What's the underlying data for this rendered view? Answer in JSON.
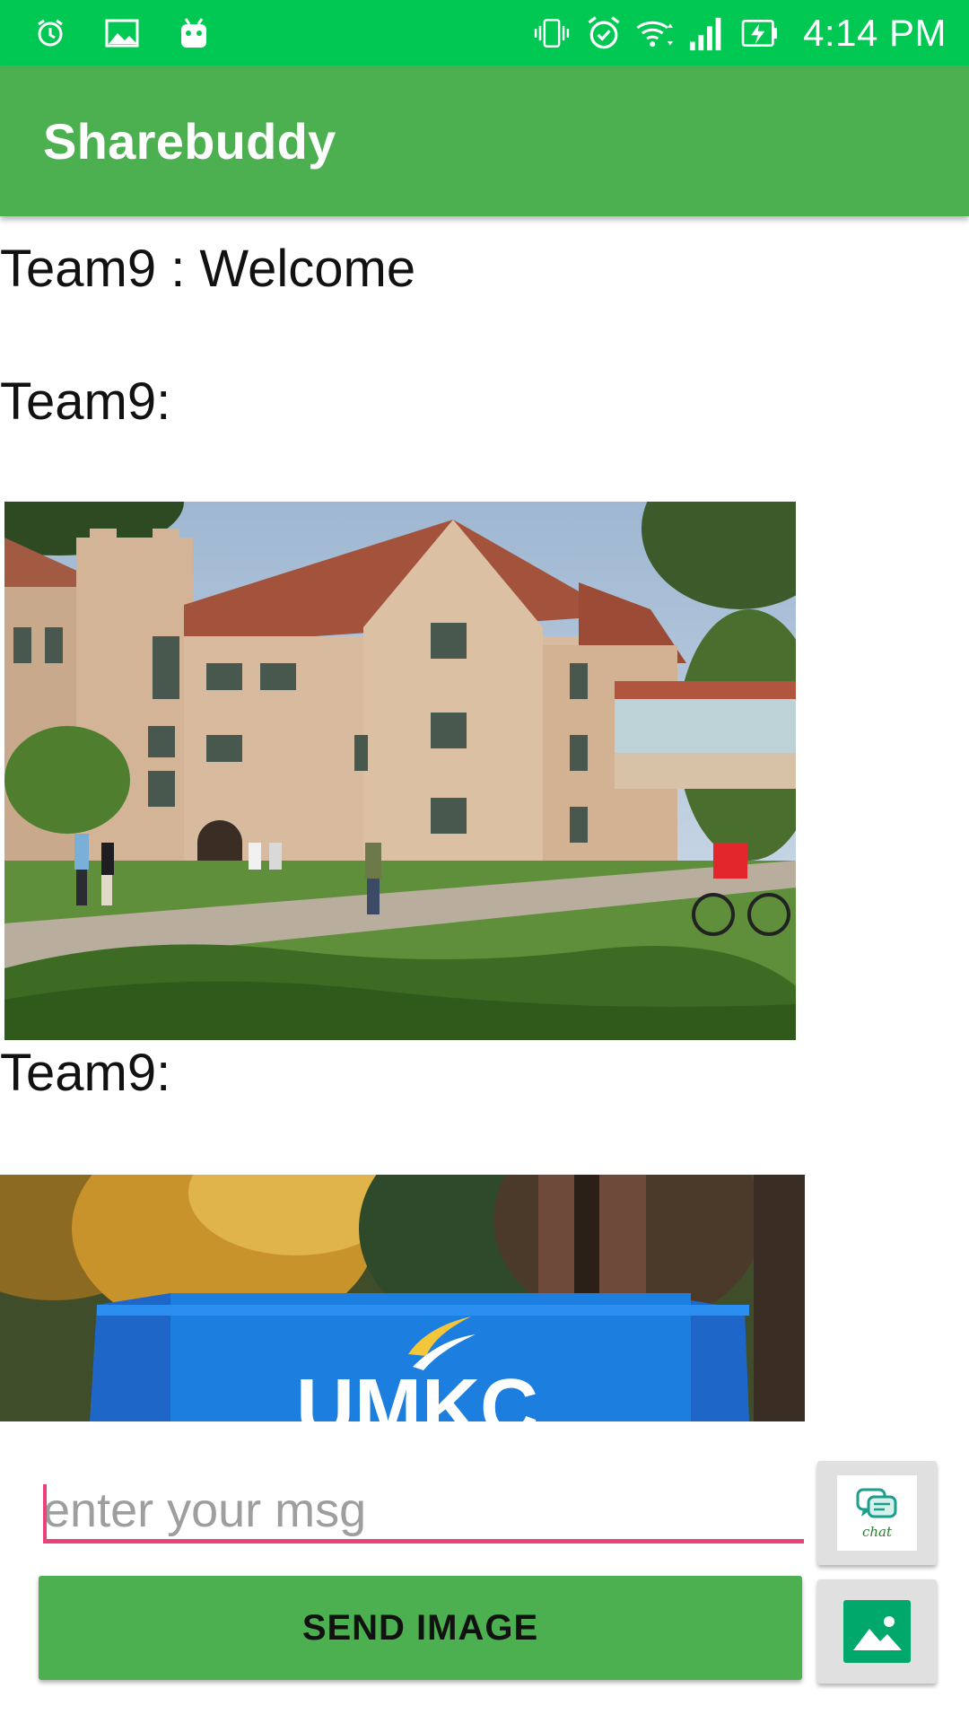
{
  "status_bar": {
    "time": "4:14 PM",
    "left_icons": [
      "alarm-icon",
      "image-icon",
      "android-icon"
    ],
    "right_icons": [
      "vibrate-icon",
      "alarm-clock-icon",
      "wifi-icon",
      "signal-icon",
      "battery-charging-icon"
    ],
    "color": "#00c853"
  },
  "app_bar": {
    "title": "Sharebuddy",
    "color": "#4caf50"
  },
  "messages": [
    {
      "text": "Team9 : Welcome"
    },
    {
      "text": "Team9:",
      "image": "building-photo"
    },
    {
      "text": "Team9:",
      "image": "sign-photo"
    }
  ],
  "sign_photo": {
    "visible_text": "UMKC"
  },
  "composer": {
    "placeholder": "enter your msg",
    "value": "",
    "send_image_label": "SEND IMAGE",
    "chat_button_caption": "chat",
    "chat_icon": "chat-bubbles-icon",
    "gallery_icon": "gallery-icon",
    "accent": "#ec407a"
  }
}
